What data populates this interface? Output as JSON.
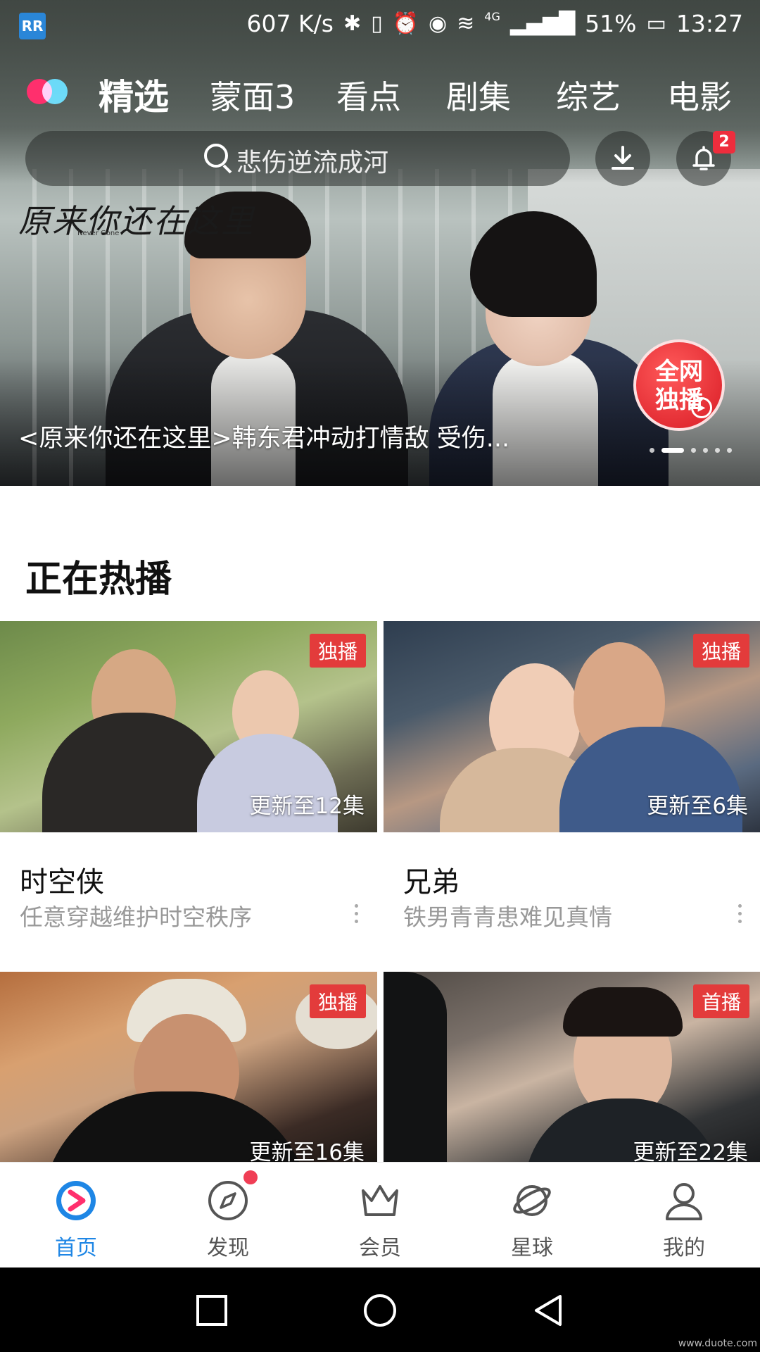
{
  "status_bar": {
    "app_badge": "RR",
    "speed": "607 K/s",
    "network": "4G",
    "battery": "51%",
    "time": "13:27"
  },
  "top_nav": {
    "tabs": [
      {
        "label": "精选",
        "active": true
      },
      {
        "label": "蒙面3",
        "active": false
      },
      {
        "label": "看点",
        "active": false
      },
      {
        "label": "剧集",
        "active": false
      },
      {
        "label": "综艺",
        "active": false
      },
      {
        "label": "电影",
        "active": false
      }
    ]
  },
  "search": {
    "placeholder": "悲伤逆流成河"
  },
  "notifications": {
    "count": "2"
  },
  "hero": {
    "logo_text": "原来你还在这里",
    "logo_sub": "Never Gone",
    "badge_text": "全网独播",
    "caption": "<原来你还在这里>韩东君冲动打情敌 受伤...",
    "slide_count": 6,
    "active_slide": 1
  },
  "section": {
    "title": "正在热播",
    "cards": [
      {
        "badge": "独播",
        "update": "更新至12集",
        "title": "时空侠",
        "desc": "任意穿越维护时空秩序"
      },
      {
        "badge": "独播",
        "update": "更新至6集",
        "title": "兄弟",
        "desc": "铁男青青患难见真情"
      },
      {
        "badge": "独播",
        "update": "更新至16集",
        "title": "",
        "desc": ""
      },
      {
        "badge": "首播",
        "update": "更新至22集",
        "title": "",
        "desc": ""
      }
    ]
  },
  "tabbar": {
    "items": [
      {
        "label": "首页",
        "icon": "youku-home-icon",
        "active": true
      },
      {
        "label": "发现",
        "icon": "compass-icon",
        "active": false
      },
      {
        "label": "会员",
        "icon": "crown-icon",
        "active": false
      },
      {
        "label": "星球",
        "icon": "planet-icon",
        "active": false
      },
      {
        "label": "我的",
        "icon": "person-icon",
        "active": false
      }
    ]
  },
  "colors": {
    "accent": "#1e86e5",
    "badge_red": "#e33b3b",
    "notify_red": "#ee2d3d"
  },
  "watermark": "www.duote.com"
}
